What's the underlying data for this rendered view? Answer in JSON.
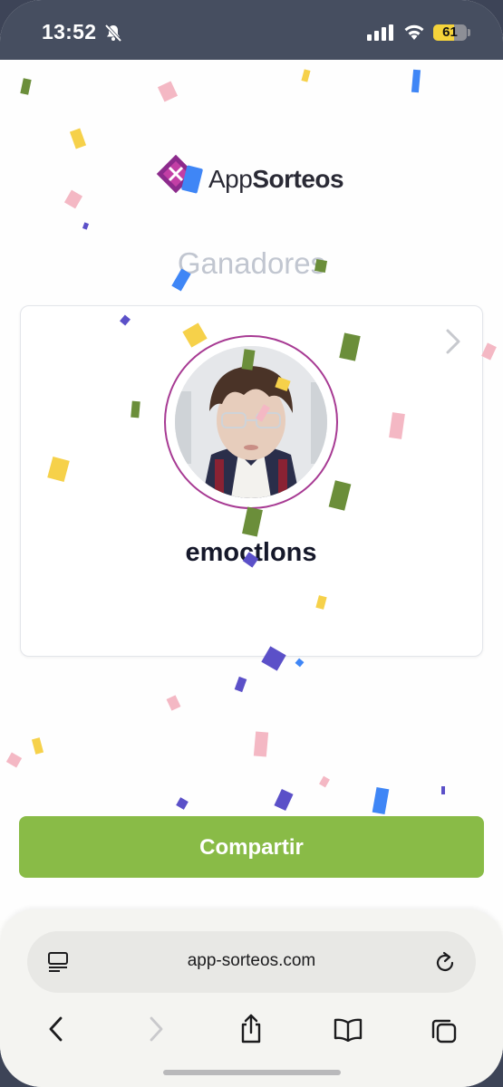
{
  "status_bar": {
    "time": "13:52",
    "battery_level": "61"
  },
  "logo": {
    "part1": "App",
    "part2": "Sorteos"
  },
  "page": {
    "heading": "Ganadores"
  },
  "winner": {
    "username": "emoctlons"
  },
  "actions": {
    "share_label": "Compartir"
  },
  "browser": {
    "url": "app-sorteos.com"
  },
  "colors": {
    "accent_green": "#89bb47",
    "brand_purple": "#a73a93",
    "brand_blue": "#3f86f6"
  },
  "icons": [
    "bell-muted-icon",
    "signal-icon",
    "wifi-icon",
    "battery-icon",
    "chevron-right-icon",
    "reader-icon",
    "reload-icon",
    "back-icon",
    "forward-icon",
    "share-icon",
    "bookmarks-icon",
    "tabs-icon"
  ]
}
